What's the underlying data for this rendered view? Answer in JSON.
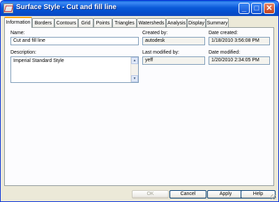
{
  "window": {
    "title": "Surface Style - Cut and fill line"
  },
  "titlebar_buttons": {
    "minimize": "_",
    "maximize": "□",
    "close": "✕"
  },
  "tabs": [
    {
      "label": "Information",
      "active": true
    },
    {
      "label": "Borders",
      "active": false
    },
    {
      "label": "Contours",
      "active": false
    },
    {
      "label": "Grid",
      "active": false
    },
    {
      "label": "Points",
      "active": false
    },
    {
      "label": "Triangles",
      "active": false
    },
    {
      "label": "Watersheds",
      "active": false
    },
    {
      "label": "Analysis",
      "active": false
    },
    {
      "label": "Display",
      "active": false
    },
    {
      "label": "Summary",
      "active": false
    }
  ],
  "info": {
    "name_label": "Name:",
    "name_value": "Cut and fill line",
    "description_label": "Description:",
    "description_value": "Imperial Standard Style",
    "created_by_label": "Created by:",
    "created_by_value": "autodesk",
    "date_created_label": "Date created:",
    "date_created_value": "1/18/2010 3:56:08 PM",
    "last_modified_by_label": "Last modified by:",
    "last_modified_by_value": "yeff",
    "date_modified_label": "Date modified:",
    "date_modified_value": "1/20/2010 2:34:05 PM"
  },
  "scrollbar": {
    "up_arrow": "▲",
    "down_arrow": "▼"
  },
  "buttons": {
    "ok": "OK",
    "cancel": "Cancel",
    "apply": "Apply",
    "help": "Help"
  }
}
